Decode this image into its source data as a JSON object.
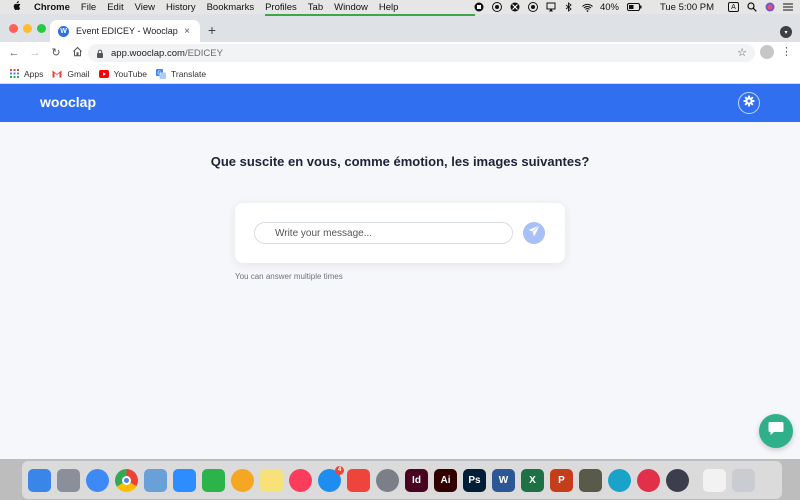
{
  "menubar": {
    "apple_icon": "apple-logo-icon",
    "app_name": "Chrome",
    "items": [
      "File",
      "Edit",
      "View",
      "History",
      "Bookmarks",
      "Profiles",
      "Tab",
      "Window",
      "Help"
    ],
    "battery": "40%",
    "clock": "Tue 5:00 PM",
    "input_source": "A"
  },
  "browser": {
    "tab_title": "Event EDICEY - Wooclap",
    "tab_favicon_letter": "W",
    "url_host": "app.wooclap.com",
    "url_path": "/EDICEY",
    "bookmarks": [
      "Apps",
      "Gmail",
      "YouTube",
      "Translate"
    ]
  },
  "wooclap": {
    "brand": "wooclap",
    "brand_color": "#2f6ff0",
    "question": "Que suscite en vous, comme émotion, les images suivantes?",
    "message_placeholder": "Write your message...",
    "hint": "You can answer multiple times",
    "chat_color": "#2fb08b"
  },
  "dock": {
    "apps": [
      {
        "name": "finder-icon",
        "color": "#3a86e8",
        "label": ""
      },
      {
        "name": "launchpad-icon",
        "color": "#8a8f99",
        "label": ""
      },
      {
        "name": "safari-icon",
        "color": "#3d8af7",
        "label": ""
      },
      {
        "name": "chrome-icon",
        "color": "#ffffff",
        "label": ""
      },
      {
        "name": "preview-icon",
        "color": "#6aa0d8",
        "label": ""
      },
      {
        "name": "zoom-icon",
        "color": "#2d8cff",
        "label": ""
      },
      {
        "name": "facetime-icon",
        "color": "#2cb34a",
        "label": ""
      },
      {
        "name": "photos-icon",
        "color": "#f5a623",
        "label": ""
      },
      {
        "name": "notes-icon",
        "color": "#f7e27a",
        "label": ""
      },
      {
        "name": "music-icon",
        "color": "#fc3c5d",
        "label": ""
      },
      {
        "name": "app-store-icon",
        "color": "#1f8cf0",
        "label": "",
        "badge": "4"
      },
      {
        "name": "anydesk-icon",
        "color": "#ef443b",
        "label": ""
      },
      {
        "name": "system-preferences-icon",
        "color": "#7b7f87",
        "label": ""
      },
      {
        "name": "indesign-icon",
        "color": "#49021f",
        "label": "Id"
      },
      {
        "name": "illustrator-icon",
        "color": "#330000",
        "label": "Ai"
      },
      {
        "name": "photoshop-icon",
        "color": "#001e36",
        "label": "Ps"
      },
      {
        "name": "word-icon",
        "color": "#2b5797",
        "label": "W"
      },
      {
        "name": "excel-icon",
        "color": "#1e7145",
        "label": "X"
      },
      {
        "name": "powerpoint-icon",
        "color": "#c43e1c",
        "label": "P"
      },
      {
        "name": "game-icon",
        "color": "#5a5a4a",
        "label": ""
      },
      {
        "name": "accessibility-icon",
        "color": "#1aa3c9",
        "label": ""
      },
      {
        "name": "creative-cloud-icon",
        "color": "#e3304a",
        "label": ""
      },
      {
        "name": "quicktime-icon",
        "color": "#3a3f4b",
        "label": ""
      },
      {
        "name": "document-icon",
        "color": "#f2f2f2",
        "label": ""
      },
      {
        "name": "trash-icon",
        "color": "#c9ccd1",
        "label": ""
      }
    ]
  }
}
